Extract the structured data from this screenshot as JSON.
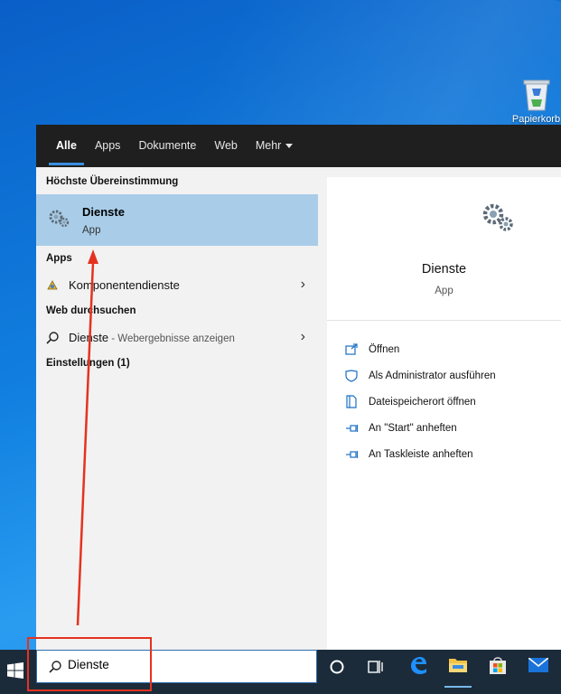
{
  "desktop": {
    "recycle_bin_label": "Papierkorb"
  },
  "search_panel": {
    "tabs": [
      {
        "label": "Alle",
        "active": true
      },
      {
        "label": "Apps",
        "active": false
      },
      {
        "label": "Dokumente",
        "active": false
      },
      {
        "label": "Web",
        "active": false
      },
      {
        "label": "Mehr",
        "active": false
      }
    ],
    "best_match": {
      "heading": "Höchste Übereinstimmung",
      "title": "Dienste",
      "subtitle": "App",
      "icon": "gears-icon"
    },
    "apps_section": {
      "heading": "Apps",
      "items": [
        {
          "label": "Komponentendienste",
          "icon": "component-services-icon"
        }
      ]
    },
    "web_section": {
      "heading": "Web durchsuchen",
      "query": "Dienste",
      "suffix": " - Webergebnisse anzeigen",
      "icon": "search-icon"
    },
    "settings_section": {
      "heading": "Einstellungen (1)"
    },
    "preview": {
      "title": "Dienste",
      "subtitle": "App",
      "icon": "gears-icon",
      "actions": [
        {
          "label": "Öffnen",
          "icon": "open-icon"
        },
        {
          "label": "Als Administrator ausführen",
          "icon": "shield-icon"
        },
        {
          "label": "Dateispeicherort öffnen",
          "icon": "file-location-icon"
        },
        {
          "label": "An \"Start\" anheften",
          "icon": "pin-icon"
        },
        {
          "label": "An Taskleiste anheften",
          "icon": "pin-icon"
        }
      ]
    }
  },
  "taskbar": {
    "search_value": "Dienste",
    "icons": [
      "windows-start-icon",
      "cortana-icon",
      "task-view-icon",
      "edge-icon",
      "file-explorer-icon",
      "store-icon",
      "mail-icon"
    ]
  },
  "colors": {
    "accent": "#3b8fe0",
    "selection": "#a9cde9",
    "annotation": "#e5321f",
    "taskbar": "#1c2b3a"
  }
}
